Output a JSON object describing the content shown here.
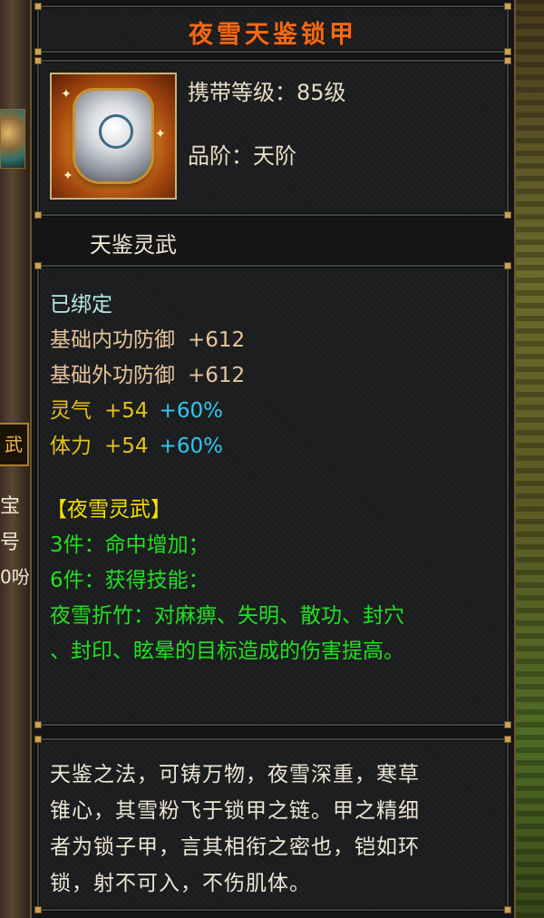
{
  "background": {
    "left_fragments": [
      {
        "id": "frag1",
        "text": "宝"
      },
      {
        "id": "frag2",
        "text": "号"
      },
      {
        "id": "frag3",
        "text": "0吩"
      }
    ],
    "left_button_text": "武"
  },
  "item": {
    "name": "夜雪天鉴锁甲",
    "name_color": "#f06a16",
    "icon": "armor-chestplate-icon",
    "carry_level": "携带等级：85级",
    "grade": "品阶：天阶",
    "subtitle": "天鉴灵武"
  },
  "stats": {
    "bound": "已绑定",
    "base": [
      {
        "label": "基础内功防御",
        "value": "+612"
      },
      {
        "label": "基础外功防御",
        "value": "+612"
      }
    ],
    "bonus": [
      {
        "label": "灵气",
        "value": "+54",
        "percent": "+60%"
      },
      {
        "label": "体力",
        "value": "+54",
        "percent": "+60%"
      }
    ],
    "set_name": "【夜雪灵武】",
    "set_effects": [
      "3件：命中增加；",
      "6件：获得技能：",
      "夜雪折竹：对麻痹、失明、散功、封穴",
      "、封印、眩晕的目标造成的伤害提高。"
    ]
  },
  "lore": {
    "lines": [
      "天鉴之法，可铸万物，夜雪深重，寒草",
      "锥心，其雪粉飞于锁甲之链。甲之精细",
      "者为锁子甲，言其相衔之密也，铠如环",
      "锁，射不可入，不伤肌体。"
    ]
  },
  "colors": {
    "panel_bg": "#1b1c1e",
    "border": "#3e4446",
    "frame_gold": "#c9a45a",
    "text_cyan": "#b6e6e6",
    "text_tan": "#e8c49a",
    "text_yellow": "#e6c21a",
    "text_blue": "#2ec8f0",
    "text_green": "#21e021",
    "text_set": "#f2e000"
  }
}
